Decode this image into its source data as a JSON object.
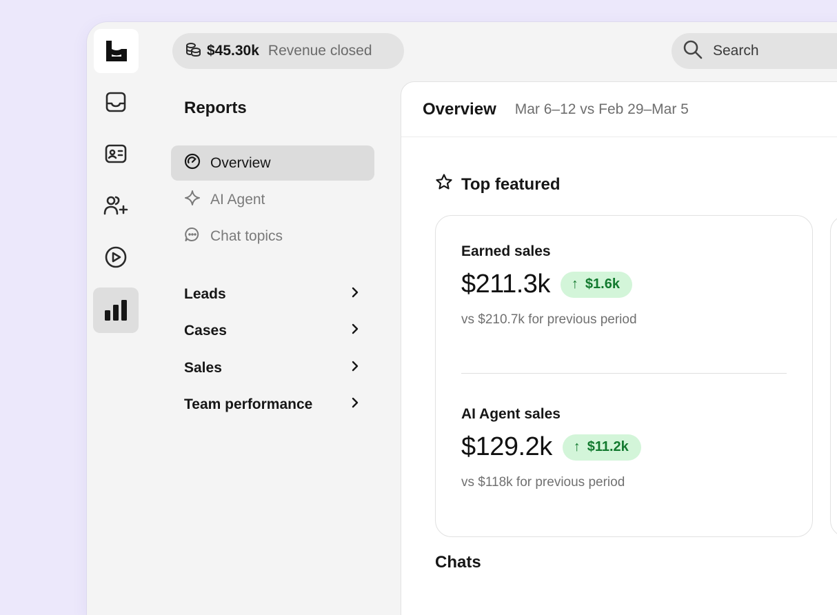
{
  "brand": {
    "logo_icon": "logo-icon"
  },
  "rail": {
    "items": [
      {
        "icon": "inbox-icon",
        "active": false
      },
      {
        "icon": "contact-card-icon",
        "active": false
      },
      {
        "icon": "users-plus-icon",
        "active": false
      },
      {
        "icon": "play-circle-icon",
        "active": false
      },
      {
        "icon": "bar-chart-icon",
        "active": true
      }
    ]
  },
  "topbar": {
    "revenue_amount": "$45.30k",
    "revenue_label": "Revenue closed",
    "search_placeholder": "Search"
  },
  "reports_nav": {
    "title": "Reports",
    "items": [
      {
        "label": "Overview",
        "icon": "gauge-icon",
        "active": true
      },
      {
        "label": "AI Agent",
        "icon": "sparkle-icon",
        "active": false
      },
      {
        "label": "Chat topics",
        "icon": "chat-bubble-icon",
        "active": false
      }
    ],
    "groups": [
      {
        "label": "Leads"
      },
      {
        "label": "Cases"
      },
      {
        "label": "Sales"
      },
      {
        "label": "Team performance"
      }
    ]
  },
  "main": {
    "title": "Overview",
    "date_range": "Mar 6–12 vs Feb 29–Mar 5",
    "section_title": "Top featured",
    "metrics": [
      {
        "name": "Earned sales",
        "value": "$211.3k",
        "delta": "$1.6k",
        "comparison": "vs $210.7k for previous period"
      },
      {
        "name": "AI Agent sales",
        "value": "$129.2k",
        "delta": "$11.2k",
        "comparison": "vs $118k for previous period"
      }
    ],
    "chats_title": "Chats"
  },
  "colors": {
    "background": "#ece8fb",
    "app": "#f4f4f4",
    "delta_bg": "#d3f5d9",
    "delta_text": "#137a2f"
  }
}
